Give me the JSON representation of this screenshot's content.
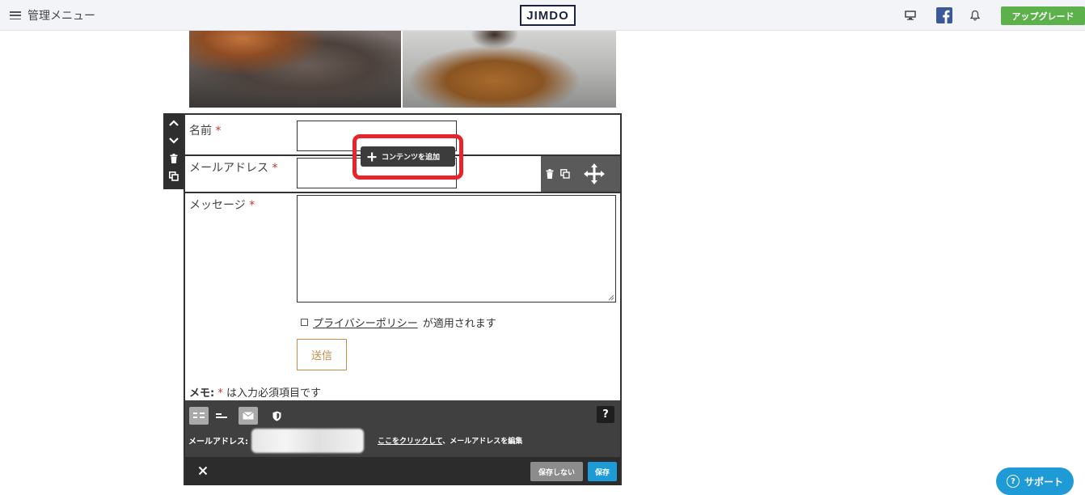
{
  "topbar": {
    "menu_label": "管理メニュー",
    "logo": "JIMDO",
    "upgrade_label": "アップグレード",
    "icons": [
      "desktop-icon",
      "facebook-icon",
      "bell-icon"
    ]
  },
  "form": {
    "fields": [
      {
        "label": "名前",
        "required": "*"
      },
      {
        "label": "メールアドレス",
        "required": "*"
      },
      {
        "label": "メッセージ",
        "required": "*"
      }
    ],
    "add_content_label": "コンテンツを追加",
    "privacy_link": "プライバシーポリシー",
    "privacy_suffix": "が適用されます",
    "send_label": "送信",
    "memo_label": "メモ:",
    "memo_required": "*",
    "memo_text": "は入力必須項目です"
  },
  "editor": {
    "help_label": "?",
    "email_label": "メールアドレス:",
    "email_edit_link": "ここをクリックして",
    "email_edit_suffix": "、メールアドレスを編集",
    "close_label": "✕",
    "no_save_label": "保存しない",
    "save_label": "保存"
  },
  "support": {
    "label": "サポート",
    "icon_glyph": "?"
  },
  "colors": {
    "accent_red": "#e8232a",
    "upgrade_green": "#5cb14a",
    "save_blue": "#1e9ad6",
    "send_orange": "#c98c47"
  }
}
